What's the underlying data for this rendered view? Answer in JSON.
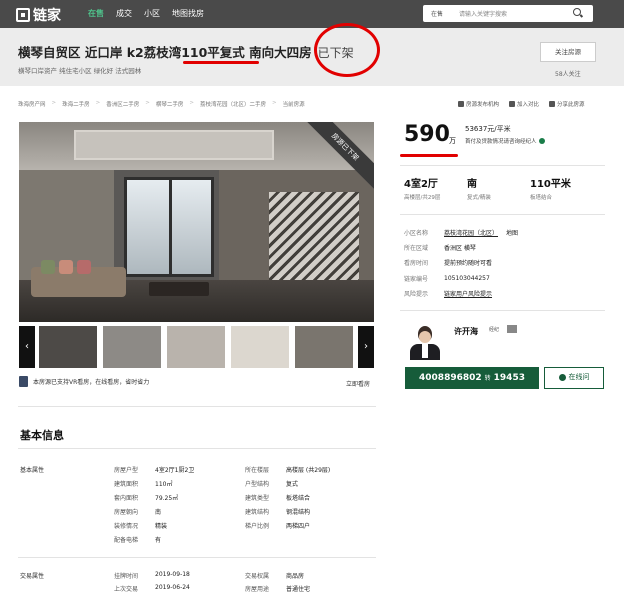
{
  "nav": {
    "logo": "链家",
    "links": [
      {
        "label": "在售",
        "active": true
      },
      {
        "label": "成交",
        "active": false
      },
      {
        "label": "小区",
        "active": false
      },
      {
        "label": "地图找房",
        "active": false
      }
    ],
    "search_select": "在售",
    "search_placeholder": "请输入关键字搜索"
  },
  "header": {
    "title": "横琴自贸区 近口岸 k2荔枝湾110平复式 南向大四房",
    "sold_tag": "已下架",
    "subtitle": "横琴口岸资产 纯住宅小区 绿化好 法式园林",
    "follow_button": "关注房源",
    "follow_count": "58人关注"
  },
  "breadcrumb": {
    "items": [
      "珠海房产网",
      "珠海二手房",
      "香洲区二手房",
      "横琴二手房",
      "荔枝湾花园（北区）二手房",
      "当前房源"
    ],
    "actions": [
      "房源发布机构",
      "加入对比",
      "分享此房源"
    ]
  },
  "photo": {
    "ribbon": "房源已下架",
    "vr_note": "本房源已支持VR看房，在线看房，省时省力",
    "vr_link": "立即看房",
    "thumb_colors": [
      "#4d4a47",
      "#8d8a86",
      "#b9b3ac",
      "#dcd7cf",
      "#7a756e"
    ]
  },
  "price": {
    "total": "590",
    "unit": "万",
    "per_sqm": "53637元/平米",
    "note": "首付及贷款情况请咨询经纪人"
  },
  "stats": [
    {
      "value": "4室2厅",
      "label": "高楼层/共29层"
    },
    {
      "value": "南",
      "label": "复式/精装"
    },
    {
      "value": "110平米",
      "label": "板塔结合"
    }
  ],
  "info": {
    "community_label": "小区名称",
    "community": "荔枝湾花园（北区）",
    "community_map": "地图",
    "area_label": "所在区域",
    "area": "香洲区 横琴",
    "viewing_label": "看房时间",
    "viewing": "提前预约随时可看",
    "id_label": "链家编号",
    "id": "105103044257",
    "risk_label": "风险提示",
    "risk": "链家用户风险提示"
  },
  "agent": {
    "name": "许开海",
    "badge": "经纪",
    "phone": "4008896802",
    "ext_label": "转",
    "ext": "19453",
    "chat": "在线问"
  },
  "basic": {
    "section_title": "基本信息",
    "group1_label": "基本属性",
    "left_rows": [
      {
        "k": "房屋户型",
        "v": "4室2厅1厨2卫"
      },
      {
        "k": "建筑面积",
        "v": "110㎡"
      },
      {
        "k": "套内面积",
        "v": "79.25㎡"
      },
      {
        "k": "房屋朝向",
        "v": "南"
      },
      {
        "k": "装修情况",
        "v": "精装"
      },
      {
        "k": "配备电梯",
        "v": "有"
      }
    ],
    "right_rows": [
      {
        "k": "所在楼层",
        "v": "高楼层 (共29层)"
      },
      {
        "k": "户型结构",
        "v": "复式"
      },
      {
        "k": "建筑类型",
        "v": "板塔结合"
      },
      {
        "k": "建筑结构",
        "v": "钢混结构"
      },
      {
        "k": "梯户比例",
        "v": "两梯四户"
      }
    ],
    "group2_label": "交易属性",
    "trade_left": [
      {
        "k": "挂牌时间",
        "v": "2019-09-18"
      },
      {
        "k": "上次交易",
        "v": "2019-06-24"
      }
    ],
    "trade_right": [
      {
        "k": "交易权属",
        "v": "商品房"
      },
      {
        "k": "房屋用途",
        "v": "普通住宅"
      }
    ]
  },
  "colors": {
    "brand_green": "#165c3a",
    "nav_bg": "#4a4a4a",
    "highlight_red": "#e10000"
  }
}
